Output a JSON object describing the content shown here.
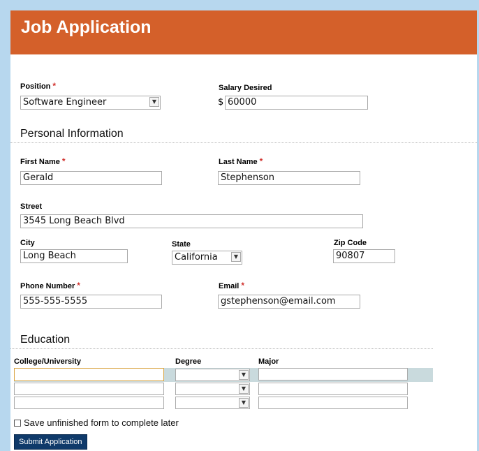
{
  "form": {
    "title": "Job Application",
    "required_marker": "*",
    "position": {
      "label": "Position",
      "value": "Software Engineer"
    },
    "salary": {
      "label": "Salary Desired",
      "currency": "$",
      "value": "60000"
    },
    "personal": {
      "heading": "Personal Information",
      "first_name": {
        "label": "First Name",
        "value": "Gerald"
      },
      "last_name": {
        "label": "Last Name",
        "value": "Stephenson"
      },
      "street": {
        "label": "Street",
        "value": "3545 Long Beach Blvd"
      },
      "city": {
        "label": "City",
        "value": "Long Beach"
      },
      "state": {
        "label": "State",
        "value": "California"
      },
      "zip": {
        "label": "Zip Code",
        "value": "90807"
      },
      "phone": {
        "label": "Phone Number",
        "value": "555-555-5555"
      },
      "email": {
        "label": "Email",
        "value": "gstephenson@email.com"
      }
    },
    "education": {
      "heading": "Education",
      "columns": [
        "College/University",
        "Degree",
        "Major"
      ],
      "rows": [
        {
          "college": "",
          "degree": "",
          "major": ""
        },
        {
          "college": "",
          "degree": "",
          "major": ""
        },
        {
          "college": "",
          "degree": "",
          "major": ""
        }
      ]
    },
    "save_later_label": "Save unfinished form to complete later",
    "submit_label": "Submit Application"
  },
  "colors": {
    "header_bg": "#d4602a",
    "page_bg": "#b7d7ee",
    "submit_bg": "#0f3a6a",
    "required": "#d0312d",
    "focus_border": "#d9a441",
    "row_highlight": "#c9dadd"
  },
  "icons": {
    "dropdown": "chevron-down-icon",
    "checkbox": "checkbox-icon"
  }
}
